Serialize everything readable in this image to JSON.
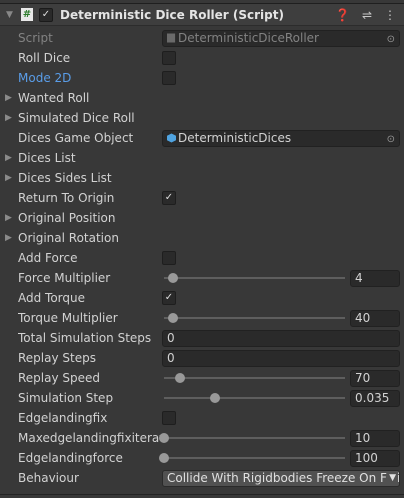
{
  "header": {
    "title": "Deterministic Dice Roller (Script)",
    "enabled": true,
    "icons": [
      "help-icon",
      "presets-icon",
      "more-icon"
    ]
  },
  "rows": [
    {
      "type": "object",
      "label": "Script",
      "value": "DeterministicDiceRoller",
      "readonly": true,
      "icon": "script-icon"
    },
    {
      "type": "checkbox",
      "label": "Roll Dice",
      "checked": false
    },
    {
      "type": "checkbox",
      "label": "Mode 2D",
      "checked": false,
      "highlight": "#5a9de8"
    },
    {
      "type": "foldout",
      "label": "Wanted Roll"
    },
    {
      "type": "foldout",
      "label": "Simulated Dice Roll"
    },
    {
      "type": "object",
      "label": "Dices Game Object",
      "value": "DeterministicDices",
      "icon": "prefab-icon"
    },
    {
      "type": "foldout",
      "label": "Dices List"
    },
    {
      "type": "foldout",
      "label": "Dices Sides List"
    },
    {
      "type": "checkbox",
      "label": "Return To Origin",
      "checked": true
    },
    {
      "type": "foldout",
      "label": "Original Position"
    },
    {
      "type": "foldout",
      "label": "Original Rotation"
    },
    {
      "type": "checkbox",
      "label": "Add Force",
      "checked": false
    },
    {
      "type": "slider",
      "label": "Force Multiplier",
      "value": "4",
      "fraction": 0.05
    },
    {
      "type": "checkbox",
      "label": "Add Torque",
      "checked": true
    },
    {
      "type": "slider",
      "label": "Torque Multiplier",
      "value": "40",
      "fraction": 0.05
    },
    {
      "type": "text",
      "label": "Total Simulation Steps",
      "value": "0"
    },
    {
      "type": "text",
      "label": "Replay Steps",
      "value": "0"
    },
    {
      "type": "slider",
      "label": "Replay Speed",
      "value": "70",
      "fraction": 0.09
    },
    {
      "type": "slider",
      "label": "Simulation Step",
      "value": "0.035",
      "fraction": 0.28
    },
    {
      "type": "checkbox",
      "label": "Edgelandingfix",
      "checked": false
    },
    {
      "type": "slider",
      "label": "Maxedgelandingfixiteratic",
      "value": "10",
      "fraction": 0.0
    },
    {
      "type": "slider",
      "label": "Edgelandingforce",
      "value": "100",
      "fraction": 0.0
    },
    {
      "type": "dropdown",
      "label": "Behaviour",
      "value": "Collide With Rigidbodies Freeze On Fini"
    }
  ]
}
